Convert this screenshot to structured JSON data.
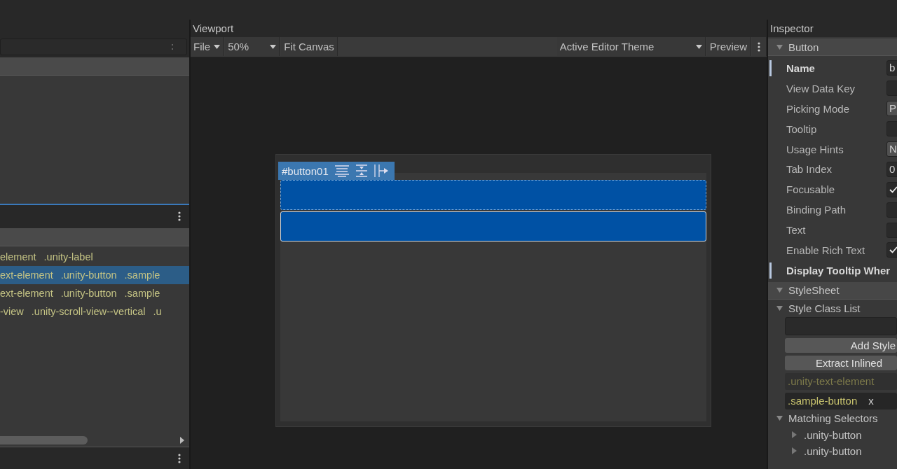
{
  "class_list": {
    "rows": [
      {
        "selected": false,
        "classes": [
          "element",
          ".unity-label"
        ]
      },
      {
        "selected": true,
        "classes": [
          "ext-element",
          ".unity-button",
          ".sample"
        ]
      },
      {
        "selected": false,
        "classes": [
          "ext-element",
          ".unity-button",
          ".sample"
        ]
      },
      {
        "selected": false,
        "classes": [
          "-view",
          ".unity-scroll-view--vertical",
          ".u"
        ]
      }
    ]
  },
  "viewport": {
    "title": "Viewport",
    "toolbar_left": [
      {
        "label": "File",
        "kind": "menu"
      },
      {
        "label": "50%",
        "kind": "dropdown"
      },
      {
        "label": "Fit Canvas",
        "kind": "button"
      }
    ],
    "toolbar_right": [
      {
        "label": "Active Editor Theme",
        "kind": "dropdown"
      },
      {
        "label": "Preview",
        "kind": "button"
      }
    ],
    "canvas": {
      "selection_tag": "#button01",
      "buttons": [
        {
          "selected": true
        },
        {
          "selected": false
        }
      ]
    }
  },
  "inspector": {
    "title": "Inspector",
    "section": "Button",
    "fields": [
      {
        "label": "Name",
        "kind": "text",
        "value": "b",
        "overridden": true
      },
      {
        "label": "View Data Key",
        "kind": "text",
        "overridden": false
      },
      {
        "label": "Picking Mode",
        "kind": "dropdown",
        "value": "P",
        "overridden": false
      },
      {
        "label": "Tooltip",
        "kind": "text",
        "overridden": false
      },
      {
        "label": "Usage Hints",
        "kind": "dropdown",
        "value": "N",
        "overridden": false
      },
      {
        "label": "Tab Index",
        "kind": "text",
        "value": "0",
        "overridden": false
      },
      {
        "label": "Focusable",
        "kind": "toggle",
        "checked": true,
        "overridden": false
      },
      {
        "label": "Binding Path",
        "kind": "text",
        "overridden": false
      },
      {
        "label": "Text",
        "kind": "text",
        "overridden": false
      },
      {
        "label": "Enable Rich Text",
        "kind": "toggle",
        "checked": true,
        "overridden": false
      },
      {
        "label": "Display Tooltip Wher",
        "kind": "label",
        "overridden": true
      }
    ],
    "stylesheet": {
      "title": "StyleSheet",
      "class_list_title": "Style Class List",
      "add_button": "Add Style",
      "extract_button": "Extract Inlined",
      "classes": [
        {
          "name": ".unity-text-element",
          "removable": false
        },
        {
          "name": ".sample-button",
          "removable": true,
          "remove": "x"
        }
      ],
      "matching_title": "Matching Selectors",
      "matching": [
        ".unity-button",
        ".unity-button"
      ]
    }
  }
}
